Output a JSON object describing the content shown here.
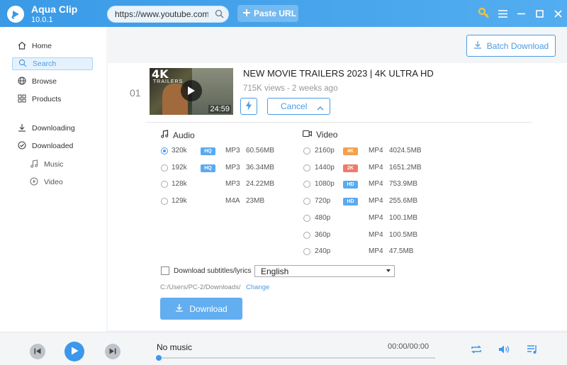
{
  "app": {
    "name": "Aqua Clip",
    "version": "10.0.1"
  },
  "header": {
    "url_value": "https://www.youtube.com/",
    "paste_label": "Paste URL"
  },
  "sidebar": {
    "items": [
      {
        "label": "Home",
        "icon": "home-icon"
      },
      {
        "label": "Search",
        "icon": "search-icon",
        "active": true
      },
      {
        "label": "Browse",
        "icon": "globe-icon"
      },
      {
        "label": "Products",
        "icon": "grid-icon"
      },
      {
        "label": "Downloading",
        "icon": "download-icon"
      },
      {
        "label": "Downloaded",
        "icon": "check-circle-icon"
      }
    ],
    "sub_items": [
      {
        "label": "Music",
        "icon": "music-note-icon"
      },
      {
        "label": "Video",
        "icon": "play-circle-icon"
      }
    ]
  },
  "main": {
    "batch_label": "Batch Download",
    "item": {
      "index": "01",
      "thumb_badge": "4K",
      "thumb_sub": "TRAILERS",
      "duration": "24:59",
      "title": "NEW MOVIE TRAILERS 2023 | 4K ULTRA HD",
      "meta": "715K views - 2 weeks ago",
      "cancel_label": "Cancel"
    },
    "audio": {
      "heading": "Audio",
      "rows": [
        {
          "quality": "320k",
          "tag": "HQ",
          "format": "MP3",
          "size": "60.56MB",
          "selected": true
        },
        {
          "quality": "192k",
          "tag": "HQ",
          "format": "MP3",
          "size": "36.34MB"
        },
        {
          "quality": "128k",
          "tag": "",
          "format": "MP3",
          "size": "24.22MB"
        },
        {
          "quality": "129k",
          "tag": "",
          "format": "M4A",
          "size": "23MB"
        }
      ]
    },
    "video": {
      "heading": "Video",
      "rows": [
        {
          "quality": "2160p",
          "tag": "4K",
          "format": "MP4",
          "size": "4024.5MB"
        },
        {
          "quality": "1440p",
          "tag": "2K",
          "format": "MP4",
          "size": "1651.2MB"
        },
        {
          "quality": "1080p",
          "tag": "HD",
          "format": "MP4",
          "size": "753.9MB"
        },
        {
          "quality": "720p",
          "tag": "HD",
          "format": "MP4",
          "size": "255.6MB"
        },
        {
          "quality": "480p",
          "tag": "",
          "format": "MP4",
          "size": "100.1MB"
        },
        {
          "quality": "360p",
          "tag": "",
          "format": "MP4",
          "size": "100.5MB"
        },
        {
          "quality": "240p",
          "tag": "",
          "format": "MP4",
          "size": "47.5MB"
        }
      ]
    },
    "subtitle_label": "Download subtitles/lyrics",
    "language": "English",
    "path": "C:/Users/PC-2/Downloads/",
    "change_label": "Change",
    "download_label": "Download"
  },
  "player": {
    "now_playing": "No music",
    "time": "00:00/00:00",
    "progress": 0
  },
  "colors": {
    "accent": "#4a9be6",
    "tag_hq": "#5aaaf0",
    "tag_4k": "#f5a04a",
    "tag_2k": "#f07a6a",
    "tag_hd": "#5aaaf0"
  }
}
